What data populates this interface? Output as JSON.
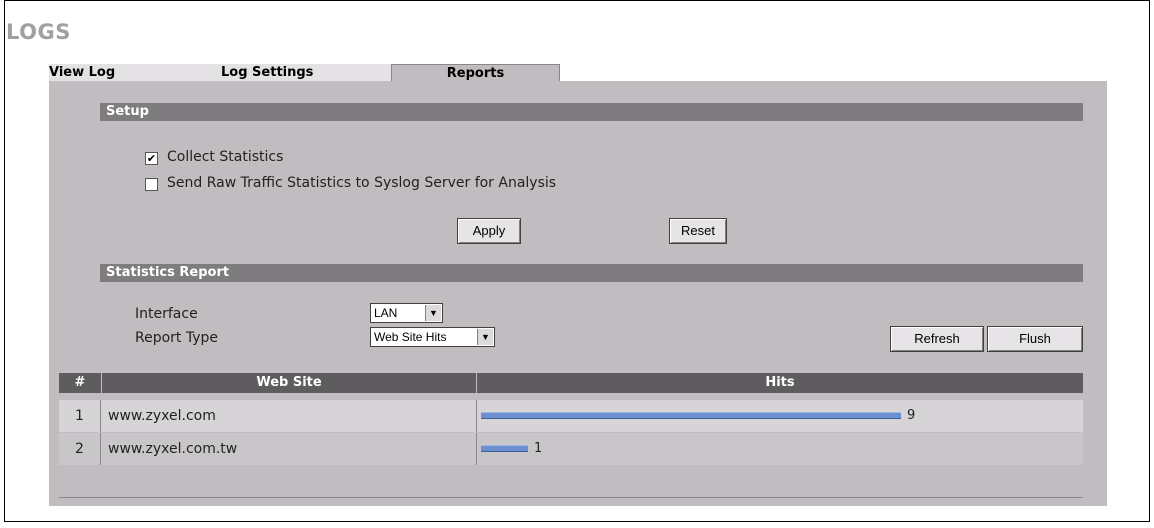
{
  "page": {
    "title": "LOGS"
  },
  "tabs": [
    {
      "label": "View Log",
      "active": false
    },
    {
      "label": "Log Settings",
      "active": false
    },
    {
      "label": "Reports",
      "active": true
    }
  ],
  "setup": {
    "heading": "Setup",
    "options": [
      {
        "label": "Collect Statistics",
        "checked": true
      },
      {
        "label": "Send Raw Traffic Statistics to Syslog Server for Analysis",
        "checked": false
      }
    ],
    "apply_label": "Apply",
    "reset_label": "Reset"
  },
  "report": {
    "heading": "Statistics Report",
    "interface_label": "Interface",
    "interface_value": "LAN",
    "type_label": "Report Type",
    "type_value": "Web Site Hits",
    "refresh_label": "Refresh",
    "flush_label": "Flush",
    "columns": [
      "#",
      "Web Site",
      "Hits"
    ],
    "rows": [
      {
        "index": "1",
        "site": "www.zyxel.com",
        "hits": 9
      },
      {
        "index": "2",
        "site": "www.zyxel.com.tw",
        "hits": 1
      }
    ]
  },
  "colors": {
    "panel": "#c0bcc0",
    "section_bar": "#7f7c7f",
    "table_header": "#5f5c5f",
    "hit_bar": "#6b8fcf",
    "row_odd": "#d6d4d6",
    "row_even": "#c9c6c9"
  },
  "icons": {
    "checkbox_checked": "checkmark-icon",
    "dropdown": "chevron-down-icon"
  }
}
